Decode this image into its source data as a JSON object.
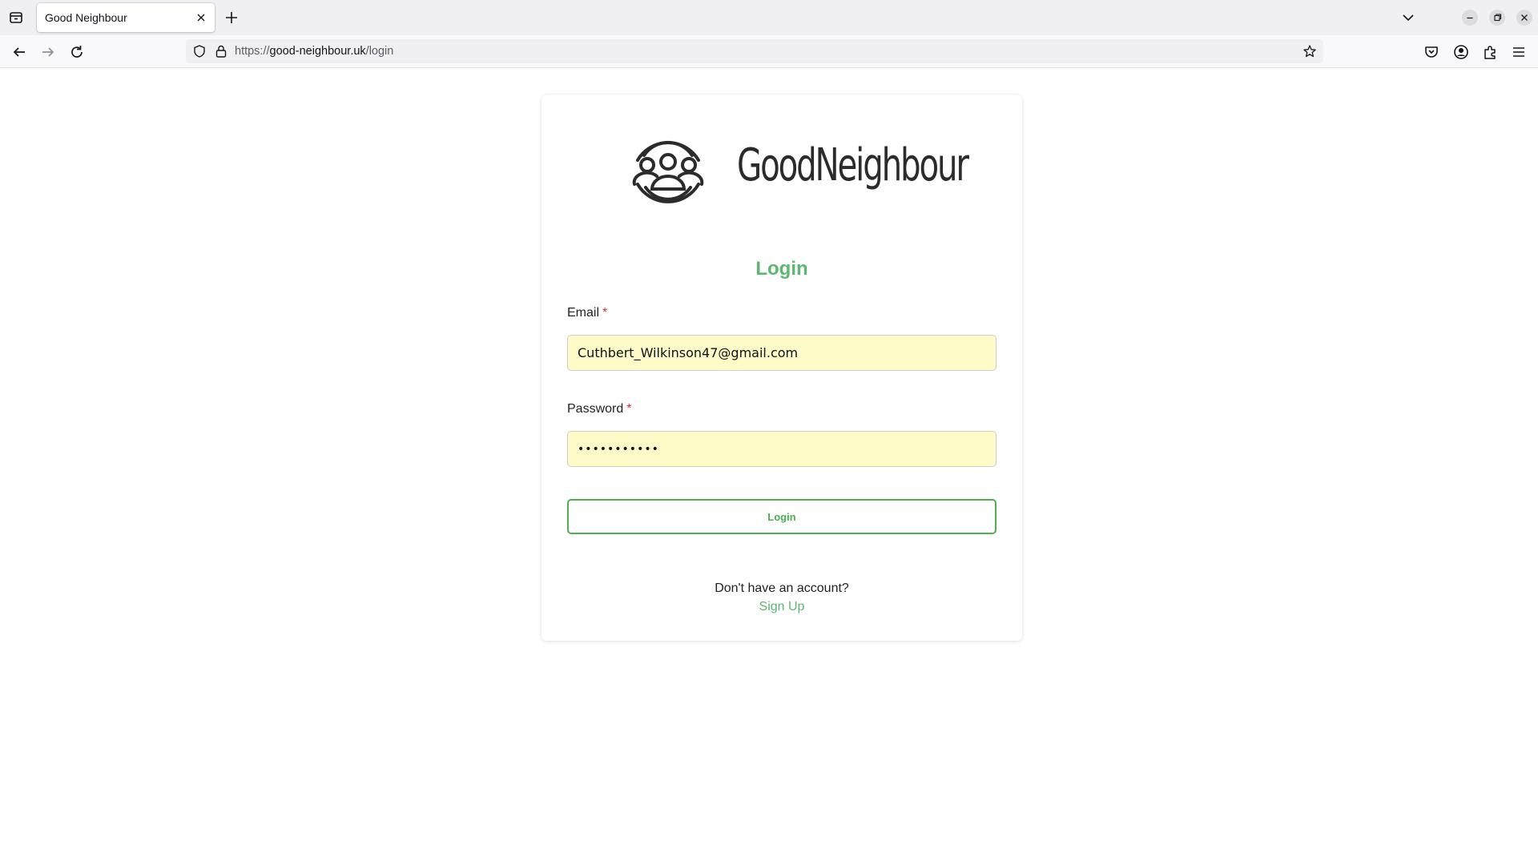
{
  "browser": {
    "tab": {
      "title": "Good Neighbour"
    },
    "url": {
      "scheme": "https://",
      "host": "good-neighbour.uk",
      "path": "/login"
    }
  },
  "brand": {
    "name": "GoodNeighbour"
  },
  "login": {
    "heading": "Login",
    "email": {
      "label": "Email",
      "required_mark": "*",
      "value": "Cuthbert_Wilkinson47@gmail.com"
    },
    "password": {
      "label": "Password",
      "required_mark": "*",
      "value": "•••••••••••"
    },
    "button_label": "Login",
    "signup_prompt": "Don't have an account?",
    "signup_link": "Sign Up"
  },
  "colors": {
    "accent": "#5cb870",
    "button_border": "#4caf50",
    "autofill_bg": "#fefbc8",
    "required": "#d32f2f"
  },
  "icons": [
    "list-all-tabs-icon",
    "close-icon",
    "plus-icon",
    "chevron-down-icon",
    "back-arrow-icon",
    "forward-arrow-icon",
    "reload-icon",
    "shield-icon",
    "lock-icon",
    "star-icon",
    "pocket-icon",
    "account-icon",
    "extensions-icon",
    "menu-icon",
    "community-logo-icon"
  ]
}
